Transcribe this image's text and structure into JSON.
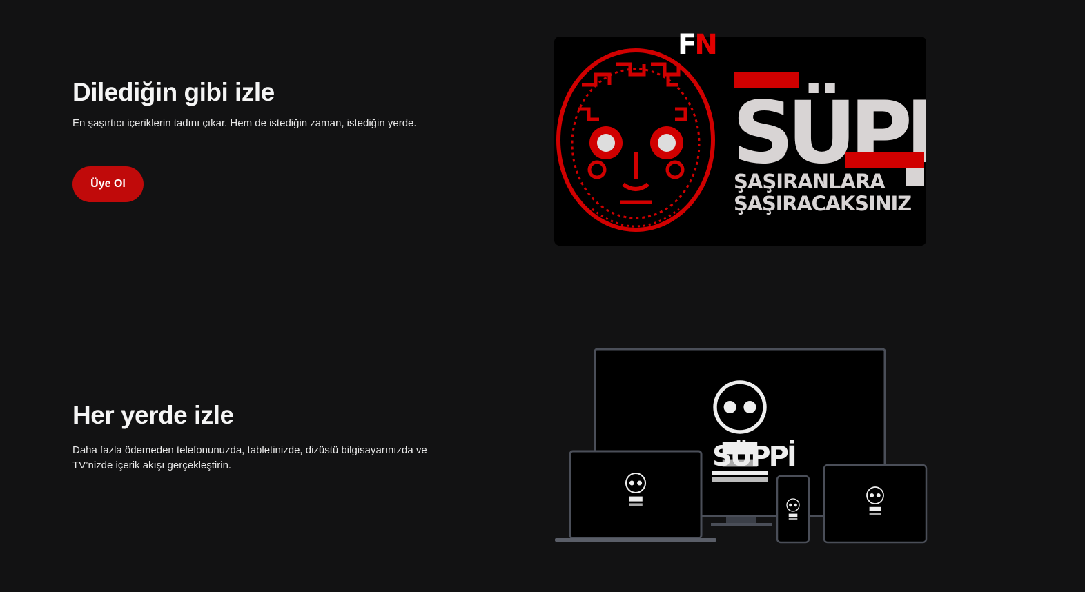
{
  "section_1": {
    "heading": "Dilediğin gibi izle",
    "description": "En şaşırtıcı içeriklerin tadını çıkar. Hem de istediğin zaman, istediğin yerde.",
    "cta_label": "Üye Ol"
  },
  "section_2": {
    "heading": "Her yerde izle",
    "description": "Daha fazla ödemeden telefonunuzda, tabletinizde, dizüstü bilgisayarınızda ve TV’nizde içerik akışı gerçekleştirin."
  },
  "promo": {
    "brand_f": "F",
    "brand_n": "N",
    "title": "SÜPPİ",
    "tagline_1": "ŞAŞIRANLARA",
    "tagline_2": "ŞAŞIRACAKSINIZ"
  },
  "colors": {
    "background": "#121213",
    "accent_red": "#c00a0a",
    "promo_red": "#d00000",
    "title_gray": "#d8d4d4"
  }
}
